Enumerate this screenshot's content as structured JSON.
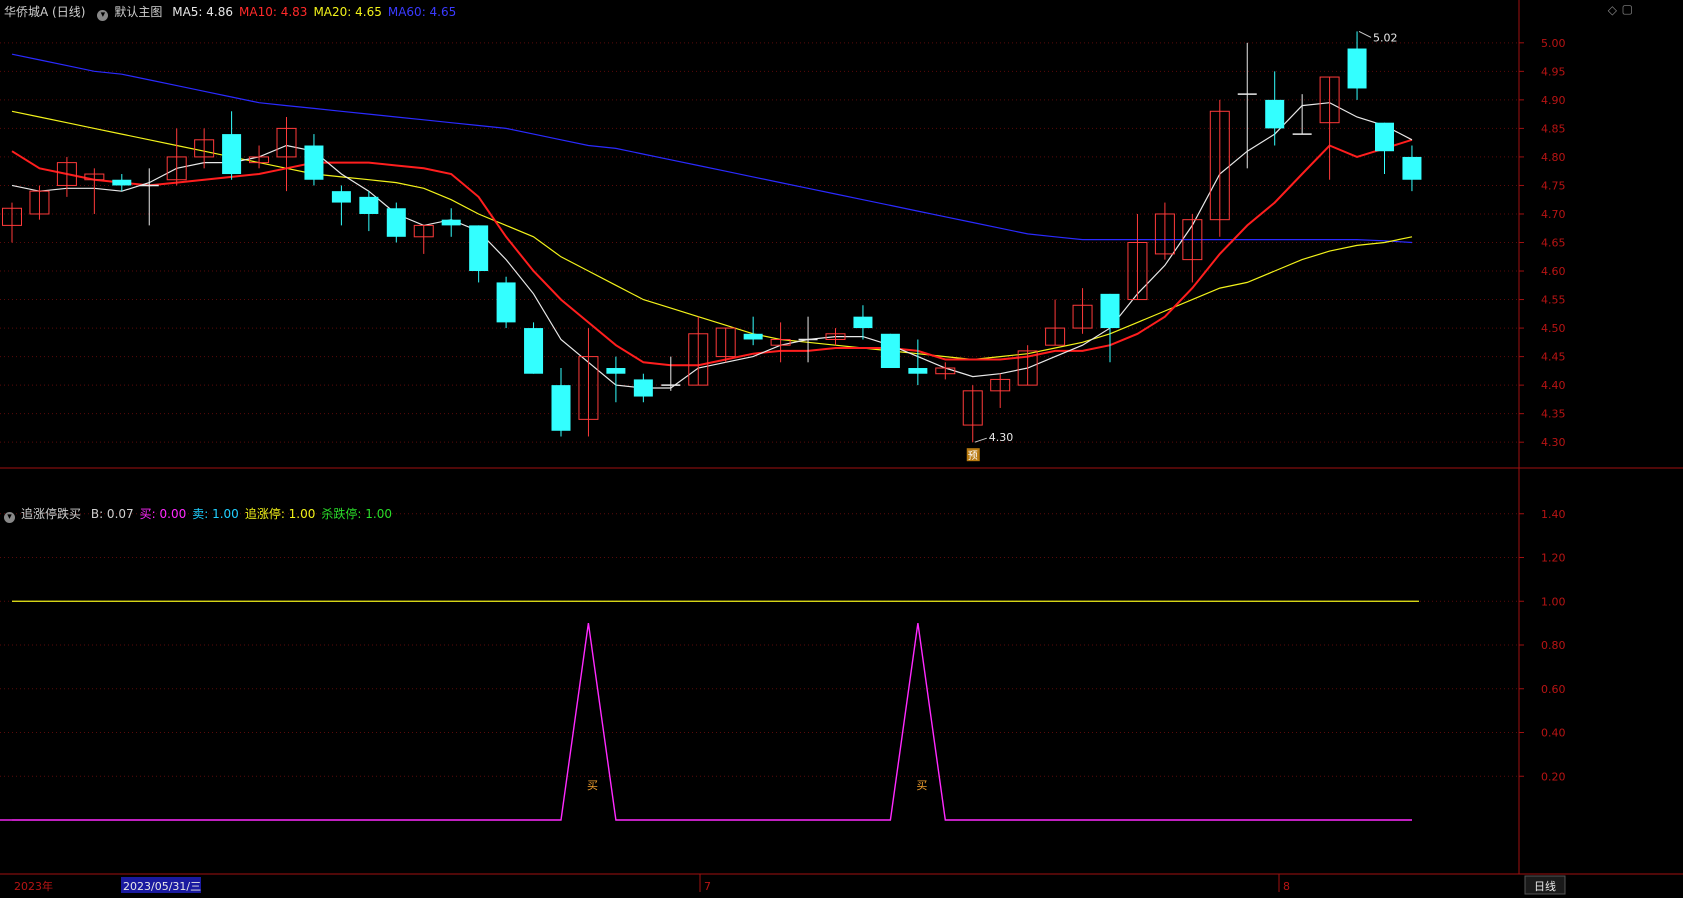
{
  "main_header": {
    "title": "华侨城A (日线)",
    "template": "默认主图",
    "ma": [
      {
        "label": "MA5: 4.86",
        "color": "#e8e8e8"
      },
      {
        "label": "MA10: 4.83",
        "color": "#ff2a2a"
      },
      {
        "label": "MA20: 4.65",
        "color": "#f2f21a"
      },
      {
        "label": "MA60: 4.65",
        "color": "#3a3aff"
      }
    ]
  },
  "sub_header": {
    "title": "追涨停跌买",
    "items": [
      {
        "label": "B: 0.07",
        "color": "#cfcfcf"
      },
      {
        "label": "买: 0.00",
        "color": "#ff2aff"
      },
      {
        "label": "卖: 1.00",
        "color": "#20d0ff"
      },
      {
        "label": "追涨停: 1.00",
        "color": "#f2f21a"
      },
      {
        "label": "杀跌停: 1.00",
        "color": "#2add2a"
      }
    ]
  },
  "bottom_bar": {
    "year": "2023年",
    "cursor_date": "2023/05/31/三",
    "month_7": "7",
    "month_8": "8",
    "period": "日线"
  },
  "colors": {
    "up": "#ff3a3a",
    "down": "#33ffff",
    "flat": "#e8e8e8",
    "ma5": "#e8e8e8",
    "ma10": "#ff1e1e",
    "ma20": "#f2f21a",
    "ma60": "#2a2aff",
    "axis": "#a01010",
    "buy_line": "#ff2aff",
    "chase_line": "#f2f21a"
  },
  "chart_data": [
    {
      "type": "candlestick",
      "ylim": [
        4.26,
        5.04
      ],
      "y_ticks": [
        "5.00",
        "4.95",
        "4.90",
        "4.85",
        "4.80",
        "4.75",
        "4.70",
        "4.65",
        "4.60",
        "4.55",
        "4.50",
        "4.45",
        "4.40",
        "4.35",
        "4.30"
      ],
      "high_annotation": "5.02",
      "low_annotation": "4.30",
      "marker_text": "预",
      "candles": [
        [
          4.68,
          4.71,
          4.65,
          4.72
        ],
        [
          4.7,
          4.74,
          4.69,
          4.75
        ],
        [
          4.75,
          4.79,
          4.73,
          4.8
        ],
        [
          4.76,
          4.77,
          4.7,
          4.78
        ],
        [
          4.76,
          4.75,
          4.74,
          4.77
        ],
        [
          4.75,
          4.75,
          4.68,
          4.78
        ],
        [
          4.76,
          4.8,
          4.75,
          4.85
        ],
        [
          4.8,
          4.83,
          4.78,
          4.85
        ],
        [
          4.84,
          4.77,
          4.76,
          4.88
        ],
        [
          4.79,
          4.8,
          4.78,
          4.82
        ],
        [
          4.8,
          4.85,
          4.74,
          4.87
        ],
        [
          4.82,
          4.76,
          4.75,
          4.84
        ],
        [
          4.74,
          4.72,
          4.68,
          4.75
        ],
        [
          4.73,
          4.7,
          4.67,
          4.74
        ],
        [
          4.71,
          4.66,
          4.65,
          4.72
        ],
        [
          4.66,
          4.68,
          4.63,
          4.68
        ],
        [
          4.69,
          4.68,
          4.66,
          4.71
        ],
        [
          4.68,
          4.6,
          4.58,
          4.68
        ],
        [
          4.58,
          4.51,
          4.5,
          4.59
        ],
        [
          4.5,
          4.42,
          4.42,
          4.51
        ],
        [
          4.4,
          4.32,
          4.31,
          4.43
        ],
        [
          4.34,
          4.45,
          4.31,
          4.5
        ],
        [
          4.43,
          4.42,
          4.37,
          4.45
        ],
        [
          4.41,
          4.38,
          4.37,
          4.42
        ],
        [
          4.4,
          4.4,
          4.39,
          4.45
        ],
        [
          4.4,
          4.49,
          4.4,
          4.52
        ],
        [
          4.45,
          4.5,
          4.44,
          4.5
        ],
        [
          4.49,
          4.48,
          4.47,
          4.52
        ],
        [
          4.47,
          4.48,
          4.44,
          4.51
        ],
        [
          4.48,
          4.48,
          4.44,
          4.52
        ],
        [
          4.48,
          4.49,
          4.47,
          4.5
        ],
        [
          4.52,
          4.5,
          4.48,
          4.54
        ],
        [
          4.49,
          4.43,
          4.43,
          4.49
        ],
        [
          4.43,
          4.42,
          4.4,
          4.48
        ],
        [
          4.42,
          4.43,
          4.41,
          4.44
        ],
        [
          4.33,
          4.39,
          4.3,
          4.4
        ],
        [
          4.39,
          4.41,
          4.36,
          4.42
        ],
        [
          4.4,
          4.46,
          4.4,
          4.47
        ],
        [
          4.47,
          4.5,
          4.47,
          4.55
        ],
        [
          4.5,
          4.54,
          4.49,
          4.57
        ],
        [
          4.56,
          4.5,
          4.44,
          4.56
        ],
        [
          4.55,
          4.65,
          4.55,
          4.7
        ],
        [
          4.63,
          4.7,
          4.62,
          4.72
        ],
        [
          4.62,
          4.69,
          4.58,
          4.7
        ],
        [
          4.69,
          4.88,
          4.66,
          4.9
        ],
        [
          4.91,
          4.91,
          4.78,
          5.0
        ],
        [
          4.9,
          4.85,
          4.82,
          4.95
        ],
        [
          4.84,
          4.84,
          4.84,
          4.91
        ],
        [
          4.86,
          4.94,
          4.76,
          4.94
        ],
        [
          4.99,
          4.92,
          4.9,
          5.02
        ],
        [
          4.86,
          4.81,
          4.77,
          4.86
        ],
        [
          4.8,
          4.76,
          4.74,
          4.82
        ]
      ],
      "ma5": [
        4.75,
        4.74,
        4.745,
        4.745,
        4.74,
        4.755,
        4.78,
        4.79,
        4.79,
        4.8,
        4.82,
        4.81,
        4.77,
        4.74,
        4.7,
        4.68,
        4.69,
        4.67,
        4.62,
        4.56,
        4.48,
        4.44,
        4.4,
        4.395,
        4.395,
        4.43,
        4.44,
        4.45,
        4.47,
        4.48,
        4.485,
        4.485,
        4.47,
        4.45,
        4.43,
        4.415,
        4.42,
        4.43,
        4.45,
        4.47,
        4.5,
        4.56,
        4.61,
        4.68,
        4.77,
        4.81,
        4.84,
        4.89,
        4.895,
        4.87,
        4.855,
        4.83
      ],
      "ma10": [
        4.81,
        4.78,
        4.77,
        4.76,
        4.755,
        4.75,
        4.755,
        4.76,
        4.765,
        4.77,
        4.78,
        4.79,
        4.79,
        4.79,
        4.785,
        4.78,
        4.77,
        4.73,
        4.66,
        4.6,
        4.55,
        4.51,
        4.47,
        4.44,
        4.435,
        4.435,
        4.445,
        4.455,
        4.46,
        4.46,
        4.465,
        4.465,
        4.465,
        4.46,
        4.445,
        4.445,
        4.445,
        4.45,
        4.46,
        4.46,
        4.47,
        4.49,
        4.52,
        4.57,
        4.63,
        4.68,
        4.72,
        4.77,
        4.82,
        4.8,
        4.815,
        4.83
      ],
      "ma20": [
        4.88,
        4.87,
        4.86,
        4.85,
        4.84,
        4.83,
        4.82,
        4.81,
        4.8,
        4.79,
        4.78,
        4.77,
        4.765,
        4.76,
        4.755,
        4.745,
        4.725,
        4.7,
        4.68,
        4.66,
        4.625,
        4.6,
        4.575,
        4.55,
        4.535,
        4.52,
        4.505,
        4.49,
        4.48,
        4.475,
        4.47,
        4.465,
        4.46,
        4.455,
        4.45,
        4.445,
        4.45,
        4.455,
        4.465,
        4.475,
        4.49,
        4.51,
        4.53,
        4.55,
        4.57,
        4.58,
        4.6,
        4.62,
        4.635,
        4.645,
        4.65,
        4.66
      ],
      "ma60": [
        4.98,
        4.97,
        4.96,
        4.95,
        4.945,
        4.935,
        4.925,
        4.915,
        4.905,
        4.895,
        4.89,
        4.885,
        4.88,
        4.875,
        4.87,
        4.865,
        4.86,
        4.855,
        4.85,
        4.84,
        4.83,
        4.82,
        4.815,
        4.805,
        4.795,
        4.785,
        4.775,
        4.765,
        4.755,
        4.745,
        4.735,
        4.725,
        4.715,
        4.705,
        4.695,
        4.685,
        4.675,
        4.665,
        4.66,
        4.655,
        4.655,
        4.655,
        4.655,
        4.655,
        4.655,
        4.655,
        4.655,
        4.655,
        4.655,
        4.655,
        4.653,
        4.65
      ]
    },
    {
      "type": "line",
      "ylim": [
        0,
        1.6
      ],
      "y_ticks": [
        "1.40",
        "1.20",
        "1.00",
        "0.80",
        "0.60",
        "0.40",
        "0.20"
      ],
      "series": [
        {
          "name": "追涨停",
          "values": [
            1,
            1,
            1,
            1,
            1,
            1,
            1,
            1,
            1,
            1,
            1,
            1,
            1,
            1,
            1,
            1,
            1,
            1,
            1,
            1,
            1,
            1,
            1,
            1,
            1,
            1,
            1,
            1,
            1,
            1,
            1,
            1,
            1,
            1,
            1,
            1,
            1,
            1,
            1,
            1,
            1,
            1,
            1,
            1,
            1,
            1,
            1,
            1,
            1,
            1,
            1,
            1
          ]
        },
        {
          "name": "买",
          "values": [
            0,
            0,
            0,
            0,
            0,
            0,
            0,
            0,
            0,
            0,
            0,
            0,
            0,
            0,
            0,
            0,
            0,
            0,
            0,
            0,
            0,
            0.9,
            0,
            0,
            0,
            0,
            0,
            0,
            0,
            0,
            0,
            0,
            0,
            0.9,
            0,
            0,
            0,
            0,
            0,
            0,
            0,
            0,
            0,
            0,
            0,
            0,
            0,
            0,
            0,
            0,
            0,
            0
          ]
        }
      ],
      "buy_label": "买",
      "buy_bars": [
        21,
        33
      ]
    }
  ]
}
